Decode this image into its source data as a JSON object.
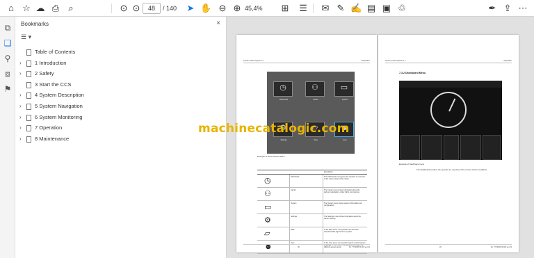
{
  "toolbar": {
    "page_current": "48",
    "page_total": "/ 140",
    "zoom": "45,4%"
  },
  "bookmarks_panel": {
    "title": "Bookmarks",
    "close": "×",
    "options": "☰ ▾",
    "items": [
      {
        "label": "Table of Contents",
        "expandable": false
      },
      {
        "label": "1 Introduction",
        "expandable": true
      },
      {
        "label": "2 Safety",
        "expandable": true
      },
      {
        "label": "3 Start the CCS",
        "expandable": false
      },
      {
        "label": "4 System Description",
        "expandable": true
      },
      {
        "label": "5 System Navigation",
        "expandable": true
      },
      {
        "label": "6 System Monitoring",
        "expandable": true
      },
      {
        "label": "7 Operation",
        "expandable": true
      },
      {
        "label": "8 Maintenance",
        "expandable": true
      }
    ]
  },
  "document": {
    "left_page": {
      "header_left": "Carrier Control System 1.x",
      "header_right": "7 Operation",
      "menu_tiles": [
        {
          "label": "Dashboard",
          "glyph": "◷"
        },
        {
          "label": "Carrier",
          "glyph": "⚇"
        },
        {
          "label": "System",
          "glyph": "▭"
        },
        {
          "label": "Settings",
          "glyph": "⚙"
        },
        {
          "label": "Data",
          "glyph": "▱"
        },
        {
          "label": "User",
          "glyph": "☻"
        }
      ],
      "figure_caption": "Example of Home Screen Menu",
      "table_head": [
        "",
        "",
        "Description"
      ],
      "rows": [
        {
          "icon": "◷",
          "name": "Dashboard",
          "desc": "The Dashboard menu gives the operator an overview of the current state of the carrier."
        },
        {
          "icon": "⚇",
          "name": "Carrier",
          "desc": "The Carrier menu shows information about the partner registration, carrier lights, and camera."
        },
        {
          "icon": "▭",
          "name": "System",
          "desc": "The System menu shows system information and configuration."
        },
        {
          "icon": "⚙",
          "name": "Settings",
          "desc": "The Settings menu shows information about the carrier settings."
        },
        {
          "icon": "▱",
          "name": "Data",
          "desc": "In the Data menu, the operator can view and download data logs from the system."
        },
        {
          "icon": "☻",
          "name": "User",
          "desc": "In the User menu, the operator selects control system language. In this menu, the operator also logs in at different access levels."
        }
      ],
      "footer_left": "48",
      "footer_right": "No. TY0000474-000 en-US"
    },
    "right_page": {
      "header_left": "Carrier Control System 1.x",
      "header_right": "7 Operation",
      "section_title": "7.3.2 Dashboard Menu",
      "figure_caption": "Example of Dashboard menu",
      "body_text": "The dashboard provides the operator an overview of the current carrier conditions.",
      "footer_left": "49",
      "footer_right": "No. TY0000474-000 en-US"
    }
  },
  "watermark": "machinecatalogic.com"
}
